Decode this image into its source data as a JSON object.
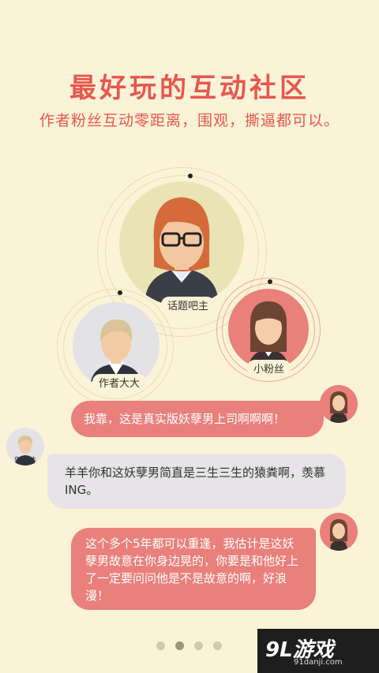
{
  "header": {
    "title": "最好玩的互动社区",
    "subtitle": "作者粉丝互动零距离，围观，撕逼都可以。"
  },
  "characters": {
    "host_label": "话题吧主",
    "fan_label": "小粉丝",
    "author_label": "作者大大"
  },
  "chat": [
    {
      "speaker": "小粉丝",
      "side": "right",
      "text": "我靠，这是真实版妖孽男上司啊啊啊！"
    },
    {
      "speaker": "作者大大",
      "side": "left",
      "text": "羊羊你和这妖孽男简直是三生三生的猿粪啊，羡慕ING。"
    },
    {
      "speaker": "小粉丝",
      "side": "right",
      "text": "这个多个5年都可以重逢，我估计是这妖孽男故意在你身边晃的，你要是和他好上了一定要问问他是不是故意的啊，好浪漫！"
    }
  ],
  "pager": {
    "count": 4,
    "active_index": 1
  },
  "watermark": {
    "brand": "9L游戏",
    "url": "91danji.com"
  },
  "colors": {
    "background": "#FBF3D7",
    "accent": "#E8574E",
    "bubble_pink": "#E9807B",
    "bubble_gray": "#E6E4E6"
  }
}
